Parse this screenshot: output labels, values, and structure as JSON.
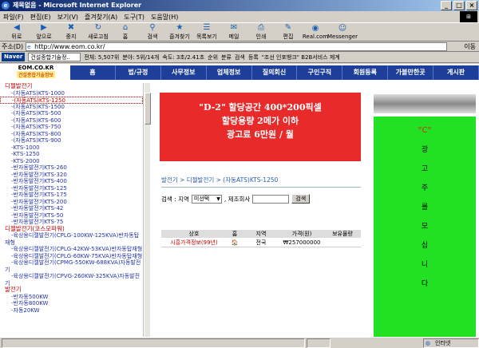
{
  "window": {
    "title": "제목없음 - Microsoft Internet Explorer"
  },
  "menu": [
    "파일(F)",
    "편집(E)",
    "보기(V)",
    "즐겨찾기(A)",
    "도구(T)",
    "도움말(H)"
  ],
  "toolbar": [
    {
      "label": "뒤로",
      "icon": "back-arrow-icon",
      "glyph": "◀"
    },
    {
      "label": "앞으로",
      "icon": "forward-arrow-icon",
      "glyph": "▶"
    },
    {
      "label": "중지",
      "icon": "stop-icon",
      "glyph": "✖"
    },
    {
      "label": "새로고침",
      "icon": "refresh-icon",
      "glyph": "↻"
    },
    {
      "label": "홈",
      "icon": "home-icon",
      "glyph": "⌂"
    },
    {
      "label": "검색",
      "icon": "search-icon",
      "glyph": "⚲"
    },
    {
      "label": "즐겨찾기",
      "icon": "favorites-icon",
      "glyph": "★"
    },
    {
      "label": "목록보기",
      "icon": "history-icon",
      "glyph": "☰"
    },
    {
      "label": "메일",
      "icon": "mail-icon",
      "glyph": "✉"
    },
    {
      "label": "인쇄",
      "icon": "print-icon",
      "glyph": "⎙"
    },
    {
      "label": "편집",
      "icon": "edit-icon",
      "glyph": "✎"
    },
    {
      "label": "Real.com",
      "icon": "real-icon",
      "glyph": "◉"
    },
    {
      "label": "Messenger",
      "icon": "messenger-icon",
      "glyph": "☺"
    }
  ],
  "address": {
    "label": "주소(D)",
    "url": "http://www.eom.co.kr/",
    "go": "이동"
  },
  "navbar": {
    "logo": "Naver",
    "dropdown": "건설종합기술정..",
    "count": "전체: 5,507위",
    "cat": "분야: 5위/14개",
    "speed": "속도: 3초/2.41초",
    "links": [
      "순위",
      "분류",
      "검색",
      "등록",
      "\"조선 인포뱅크\" B2B서비스 제계"
    ]
  },
  "brand": {
    "name": "EOM.CO.KR",
    "tag": "건설종합기술정보"
  },
  "mainnav": [
    "홈",
    "법/규정",
    "사무정보",
    "업체정보",
    "질의회신",
    "구인구직",
    "회원등록",
    "가볼만한곳",
    "게시판"
  ],
  "sidebar": [
    {
      "t": "cat",
      "text": "디젤발전기"
    },
    {
      "t": "it",
      "text": "-(자동ATS)KTS-1000"
    },
    {
      "t": "it",
      "text": "-(자동ATS)KTS-1250",
      "sel": true
    },
    {
      "t": "it",
      "text": "-(자동ATS)KTS-1500"
    },
    {
      "t": "it",
      "text": "-(자동ATS)KTS-500"
    },
    {
      "t": "it",
      "text": "-(자동ATS)KTS-600"
    },
    {
      "t": "it",
      "text": "-(자동ATS)KTS-750"
    },
    {
      "t": "it",
      "text": "-(자동ATS)KTS-800"
    },
    {
      "t": "it",
      "text": "-(자동ATS)KTS-900"
    },
    {
      "t": "it",
      "text": "-KTS-1000"
    },
    {
      "t": "it",
      "text": "-KTS-1250"
    },
    {
      "t": "it",
      "text": "-KTS-2000"
    },
    {
      "t": "it",
      "text": "-반자동발전기KTS-260"
    },
    {
      "t": "it",
      "text": "-반자동발전기KTS-320"
    },
    {
      "t": "it",
      "text": "-반자동발전기KTS-400"
    },
    {
      "t": "it",
      "text": "-반자동발전기KTS-125"
    },
    {
      "t": "it",
      "text": "-반자동발전기KTS-175"
    },
    {
      "t": "it",
      "text": "-반자동발전기KTS-200"
    },
    {
      "t": "it",
      "text": "-반자동발전기KTS-42"
    },
    {
      "t": "it",
      "text": "-반자동발전기KTS-50"
    },
    {
      "t": "it",
      "text": "-반자동발전기KTS-75"
    },
    {
      "t": "cat",
      "text": "디젤발전기(코스모파워)"
    },
    {
      "t": "it",
      "wrap": true,
      "text": "-육상용디젤발전기(CPLG-100KW-125KVA)반자동탑재형"
    },
    {
      "t": "it",
      "wrap": true,
      "text": "-육상용디젤발전기(CPLG-42KW-53KVA)반자동탑재형"
    },
    {
      "t": "it",
      "wrap": true,
      "text": "-육상용디젤발전기(CPLG-60KW-75KVA)반자동탑재형"
    },
    {
      "t": "it",
      "wrap": true,
      "text": "-육상용디젤발전기(CPMG-550KW-688KVA)자동발전기"
    },
    {
      "t": "it",
      "wrap": true,
      "text": "-육상용디젤발전기(CPVG-260KW-325KVA)자동발전기"
    },
    {
      "t": "cat",
      "text": "발전기"
    },
    {
      "t": "it",
      "text": "-반자동500KW"
    },
    {
      "t": "it",
      "text": "-반자동800KW"
    },
    {
      "t": "it",
      "text": "-자동20KW"
    }
  ],
  "ad": {
    "lines": [
      "\"D-2\" 할당공간 400*200픽셀",
      "할당용량 2메가 이하",
      "광고료 6만원 / 월"
    ]
  },
  "breadcrumb": "발전기 > 디젤발전기 > (자동ATS)KTS-1250",
  "search": {
    "label": "검색 : 지역",
    "region": "미선택",
    "company_label": ", 제조회사",
    "button": "검색"
  },
  "table": {
    "headers": [
      "상호",
      "홈",
      "지역",
      "가격(원)",
      "보유물량"
    ],
    "rows": [
      {
        "name": "시흥가격정보(99년)",
        "home": "🏠",
        "region": "전국",
        "price": "₩257000000",
        "stock": ""
      }
    ]
  },
  "right_ad": {
    "title": "\"C\"",
    "chars": [
      "광",
      "고",
      "주",
      "를",
      "모",
      "십",
      "니",
      "다"
    ]
  },
  "status": {
    "zone": "인터넷"
  }
}
